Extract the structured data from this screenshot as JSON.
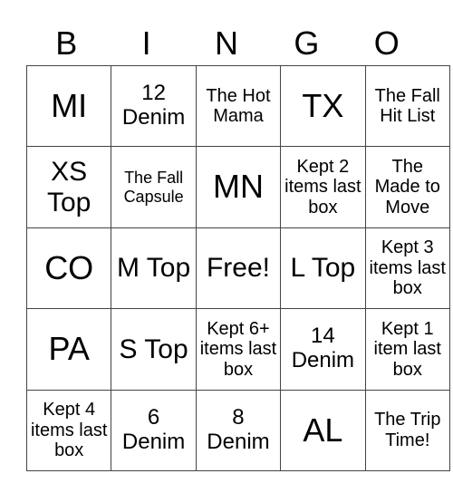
{
  "header": [
    "B",
    "I",
    "N",
    "G",
    "O"
  ],
  "cells": [
    [
      "MI",
      "12 Denim",
      "The Hot Mama",
      "TX",
      "The Fall Hit List"
    ],
    [
      "XS Top",
      "The Fall Capsule",
      "MN",
      "Kept 2 items last box",
      "The Made to Move"
    ],
    [
      "CO",
      "M Top",
      "Free!",
      "L Top",
      "Kept 3 items last box"
    ],
    [
      "PA",
      "S Top",
      "Kept 6+ items last box",
      "14 Denim",
      "Kept 1 item last box"
    ],
    [
      "Kept 4 items last box",
      "6 Denim",
      "8 Denim",
      "AL",
      "The Trip Time!"
    ]
  ]
}
